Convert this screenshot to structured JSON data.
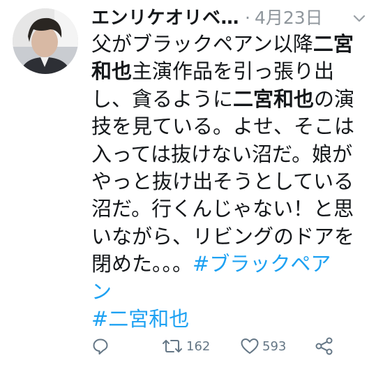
{
  "tweet": {
    "author_name": "エンリケオリベ…",
    "separator": "·",
    "date": "4月23日",
    "lines": [
      [
        {
          "t": "父がブラックペアン以降",
          "s": "n"
        },
        {
          "t": "二宮",
          "s": "b"
        }
      ],
      [
        {
          "t": "和也",
          "s": "b"
        },
        {
          "t": "主演作品を引っ張り出",
          "s": "n"
        }
      ],
      [
        {
          "t": "し、貪るように",
          "s": "n"
        },
        {
          "t": "二宮和也",
          "s": "b"
        },
        {
          "t": "の演",
          "s": "n"
        }
      ],
      [
        {
          "t": "技を見ている。よせ、そこは",
          "s": "n"
        }
      ],
      [
        {
          "t": "入っては抜けない沼だ。娘が",
          "s": "n"
        }
      ],
      [
        {
          "t": "やっと抜け出そうとしている",
          "s": "n"
        }
      ],
      [
        {
          "t": "沼だ。行くんじゃない！と思",
          "s": "n"
        }
      ],
      [
        {
          "t": "いながら、リビングのドアを",
          "s": "n"
        }
      ],
      [
        {
          "t": "閉めた。。。",
          "s": "n"
        },
        {
          "t": "#ブラックペア",
          "s": "h"
        }
      ],
      [
        {
          "t": "ン",
          "s": "h"
        }
      ],
      [
        {
          "t": "#二宮和也",
          "s": "h"
        }
      ]
    ],
    "actions": {
      "reply_icon": "reply-icon",
      "retweet_icon": "retweet-icon",
      "retweet_count": "162",
      "like_icon": "heart-icon",
      "like_count": "593",
      "share_icon": "share-icon"
    },
    "colors": {
      "text": "#14171a",
      "meta": "#8f969c",
      "hashtag": "#1da1f2",
      "action": "#657786"
    }
  }
}
